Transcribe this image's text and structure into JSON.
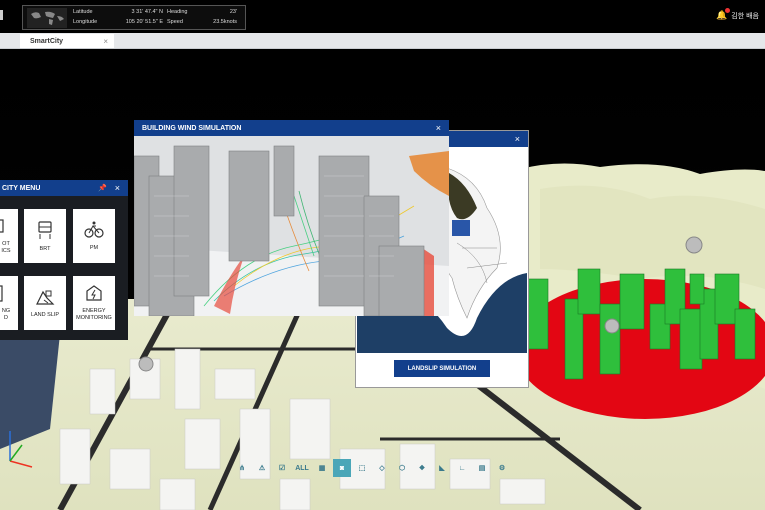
{
  "topbar": {
    "nav": {
      "latitude_label": "Latitude",
      "latitude_value": "3 31' 47.4\" N",
      "longitude_label": "Longitude",
      "longitude_value": "105 20' 51.5\" E",
      "heading_label": "Heading",
      "heading_value": "23'",
      "speed_label": "Speed",
      "speed_value": "23.5knots"
    },
    "user_name": "김한 배음"
  },
  "tabs": [
    {
      "label": "SmartCity",
      "close": "×"
    }
  ],
  "wind_panel": {
    "title": "BUILDING WIND SIMULATION",
    "close": "×"
  },
  "landslip_panel": {
    "close": "×",
    "button_label": "LANDSLIP SIMULATION"
  },
  "city_menu": {
    "title": "CITY MENU",
    "pin": "📌",
    "close": "×",
    "tiles": [
      {
        "label": "OT\nICS",
        "icon": "iot-icon"
      },
      {
        "label": "BRT",
        "icon": "bus-stop-icon"
      },
      {
        "label": "PM",
        "icon": "bicycle-icon"
      },
      {
        "label": "NG\nD",
        "icon": "building-icon"
      },
      {
        "label": "LAND SLIP",
        "icon": "landslide-icon"
      },
      {
        "label": "ENERGY\nMONITORING",
        "icon": "energy-building-icon"
      }
    ]
  },
  "toolbar": {
    "items": [
      {
        "icon": "hierarchy-icon",
        "text": ""
      },
      {
        "icon": "alert-icon",
        "text": ""
      },
      {
        "icon": "check-layers-icon",
        "text": ""
      },
      {
        "icon": "all-icon",
        "text": "ALL"
      },
      {
        "icon": "model-icon",
        "text": ""
      },
      {
        "icon": "cylinder-icon",
        "text": ""
      },
      {
        "icon": "box-3d-icon",
        "text": ""
      },
      {
        "icon": "plane-icon",
        "text": ""
      },
      {
        "icon": "cube-icon",
        "text": ""
      },
      {
        "icon": "footprint-icon",
        "text": ""
      },
      {
        "icon": "corner-icon",
        "text": ""
      },
      {
        "icon": "angle-icon",
        "text": ""
      },
      {
        "icon": "document-icon",
        "text": ""
      },
      {
        "icon": "settings-icon",
        "text": ""
      }
    ],
    "active_index": 5
  },
  "colors": {
    "header_blue": "#123f8c",
    "tool_accent": "#4aa6b8",
    "danger_zone": "#e30613",
    "building_green": "#2fbf3c"
  }
}
